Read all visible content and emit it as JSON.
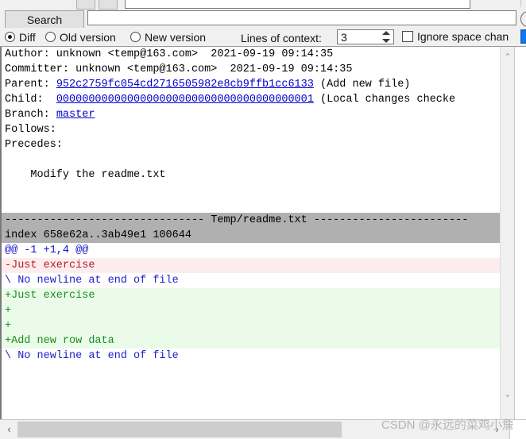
{
  "toolbar": {
    "search_button_label": "Search",
    "search_input_value": "",
    "search_input_placeholder": ""
  },
  "options": {
    "radios": [
      {
        "label": "Diff",
        "checked": true
      },
      {
        "label": "Old version",
        "checked": false
      },
      {
        "label": "New version",
        "checked": false
      }
    ],
    "context_label": "Lines of context:",
    "context_value": "3",
    "ignore_space_label": "Ignore space chan"
  },
  "commit": {
    "author_line": "Author: unknown <temp@163.com>  2021-09-19 09:14:35",
    "committer_line": "Committer: unknown <temp@163.com>  2021-09-19 09:14:35",
    "parent_label": "Parent: ",
    "parent_hash": "952c2759fc054cd2716505982e8cb9ffb1cc6133",
    "parent_note": " (Add new file)",
    "child_label": "Child:  ",
    "child_hash": "0000000000000000000000000000000000000001",
    "child_note": " (Local changes checke",
    "branch_label": "Branch: ",
    "branch_value": "master",
    "follows_line": "Follows:",
    "precedes_line": "Precedes:",
    "message": "    Modify the readme.txt"
  },
  "diff": {
    "file_band": "------------------------------- Temp/readme.txt ------------------------",
    "index_line": "index 658e62a..3ab49e1 100644",
    "hunk_header": "@@ -1 +1,4 @@",
    "lines": [
      {
        "text": "-Just exercise",
        "kind": "del"
      },
      {
        "text": "\\ No newline at end of file",
        "kind": "nonl"
      },
      {
        "text": "+Just exercise",
        "kind": "add"
      },
      {
        "text": "+",
        "kind": "add"
      },
      {
        "text": "+",
        "kind": "add"
      },
      {
        "text": "+Add new row data",
        "kind": "add"
      },
      {
        "text": "\\ No newline at end of file",
        "kind": "nonl"
      }
    ]
  },
  "scrollbars": {
    "v_up_glyph": "⌃",
    "v_down_glyph": "⌄",
    "h_left_glyph": "‹",
    "h_right_glyph": "›"
  },
  "watermark": {
    "text": "CSDN @永远的菜鸡小詹"
  },
  "colors": {
    "add_bg": "#eafbe9",
    "add_fg": "#1e8c1e",
    "del_bg": "#fdecee",
    "del_fg": "#b02020",
    "hunk_fg": "#1414c8",
    "link_fg": "#0000cd",
    "band_bg": "#b0b0b0",
    "chrome_bg": "#f0f0f0",
    "focus_blue": "#0a7cf0"
  }
}
